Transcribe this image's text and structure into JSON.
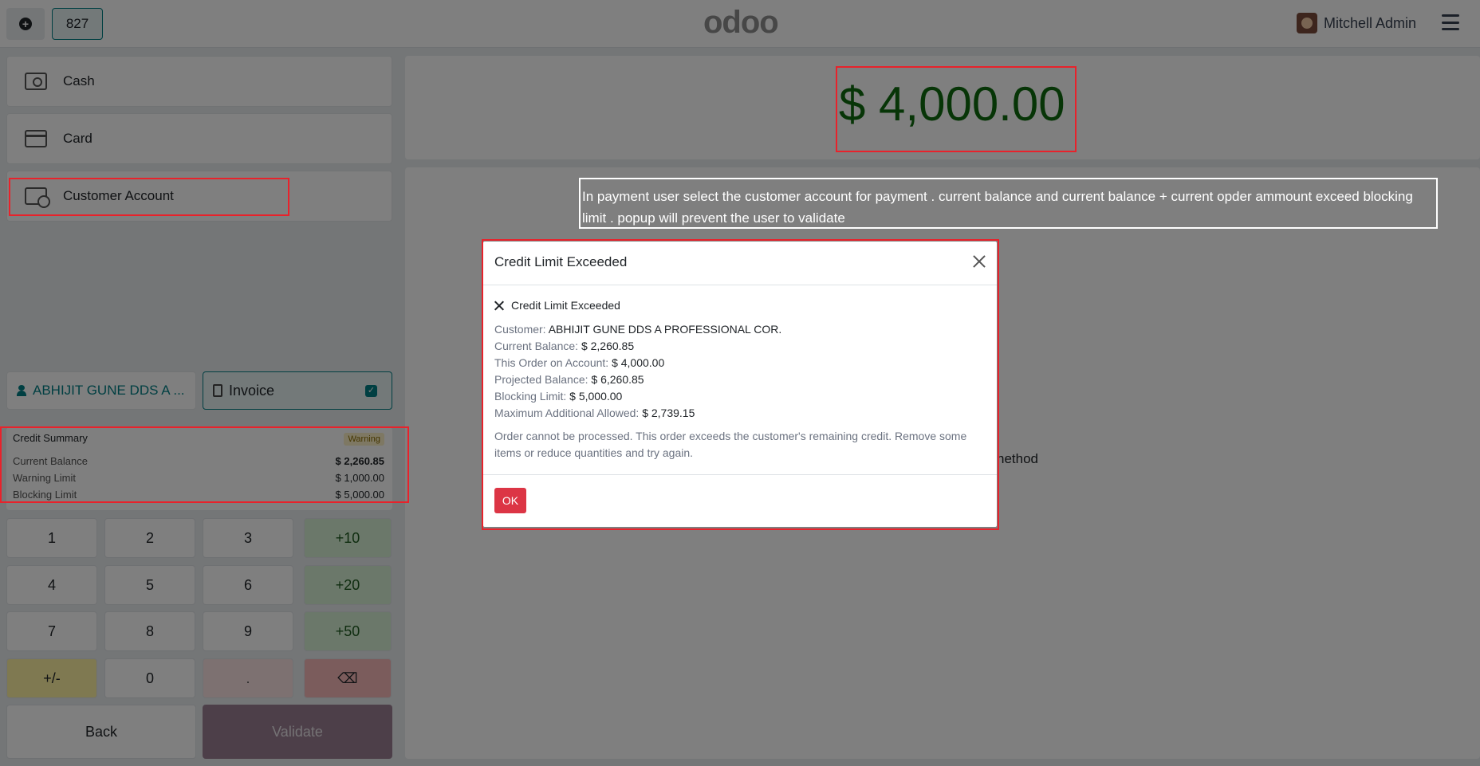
{
  "topbar": {
    "order_number": "827",
    "logo_text": "odoo",
    "user_name": "Mitchell Admin"
  },
  "payment_methods": [
    {
      "label": "Cash",
      "icon": "cash-icon"
    },
    {
      "label": "Card",
      "icon": "card-icon"
    },
    {
      "label": "Customer Account",
      "icon": "customer-account-icon"
    }
  ],
  "customer": {
    "name": "ABHIJIT GUNE DDS A ...",
    "invoice_label": "Invoice"
  },
  "credit_summary": {
    "title": "Credit Summary",
    "badge": "Warning",
    "rows": [
      {
        "label": "Current Balance",
        "value": "$ 2,260.85"
      },
      {
        "label": "Warning Limit",
        "value": "$ 1,000.00"
      },
      {
        "label": "Blocking Limit",
        "value": "$ 5,000.00"
      }
    ]
  },
  "keypad": {
    "keys": [
      "1",
      "2",
      "3",
      "+10",
      "4",
      "5",
      "6",
      "+20",
      "7",
      "8",
      "9",
      "+50",
      "+/-",
      "0",
      ".",
      "⌫"
    ]
  },
  "actions": {
    "back": "Back",
    "validate": "Validate"
  },
  "amount_due": "$ 4,000.00",
  "background_text": "nethod",
  "annotation": "In payment  user select the customer account  for payment .  current balance  and current balance + current opder ammount   exceed  blocking limit . popup  will prevent the user  to validate",
  "modal": {
    "title": "Credit Limit Exceeded",
    "error_line": "Credit Limit Exceeded",
    "fields": [
      {
        "label": "Customer:",
        "value": "ABHIJIT GUNE DDS A PROFESSIONAL COR."
      },
      {
        "label": "Current Balance:",
        "value": "$ 2,260.85"
      },
      {
        "label": "This Order on Account:",
        "value": "$ 4,000.00"
      },
      {
        "label": "Projected Balance:",
        "value": "$ 6,260.85"
      },
      {
        "label": "Blocking Limit:",
        "value": "$ 5,000.00"
      },
      {
        "label": "Maximum Additional Allowed:",
        "value": "$ 2,739.15"
      }
    ],
    "message": "Order cannot be processed. This order exceeds the customer's remaining credit. Remove some items or reduce quantities and try again.",
    "ok_label": "OK"
  }
}
